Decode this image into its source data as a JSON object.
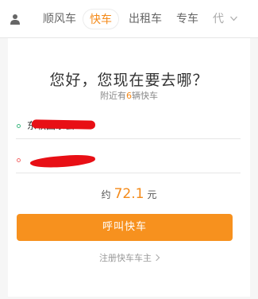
{
  "nav": {
    "user_icon": "user-icon",
    "tabs": [
      {
        "label": "顺风车",
        "active": false
      },
      {
        "label": "快车",
        "active": true
      },
      {
        "label": "出租车",
        "active": false
      },
      {
        "label": "专车",
        "active": false
      },
      {
        "label": "代",
        "active": false
      }
    ],
    "more_icon": "chevron-down-icon"
  },
  "main": {
    "greeting": "您好，您现在要去哪？",
    "nearby_prefix": "附近有",
    "nearby_count": "6",
    "nearby_suffix": "辆快车",
    "from_address": "东软国系会",
    "to_address": "",
    "price_prefix": "约",
    "price_amount": "72.1",
    "price_unit": "元",
    "call_button": "呼叫快车",
    "register_link": "注册快车车主"
  },
  "colors": {
    "accent": "#f7911e",
    "from_dot": "#3fb882",
    "to_dot": "#f36b6b",
    "redaction": "#e80f15"
  }
}
